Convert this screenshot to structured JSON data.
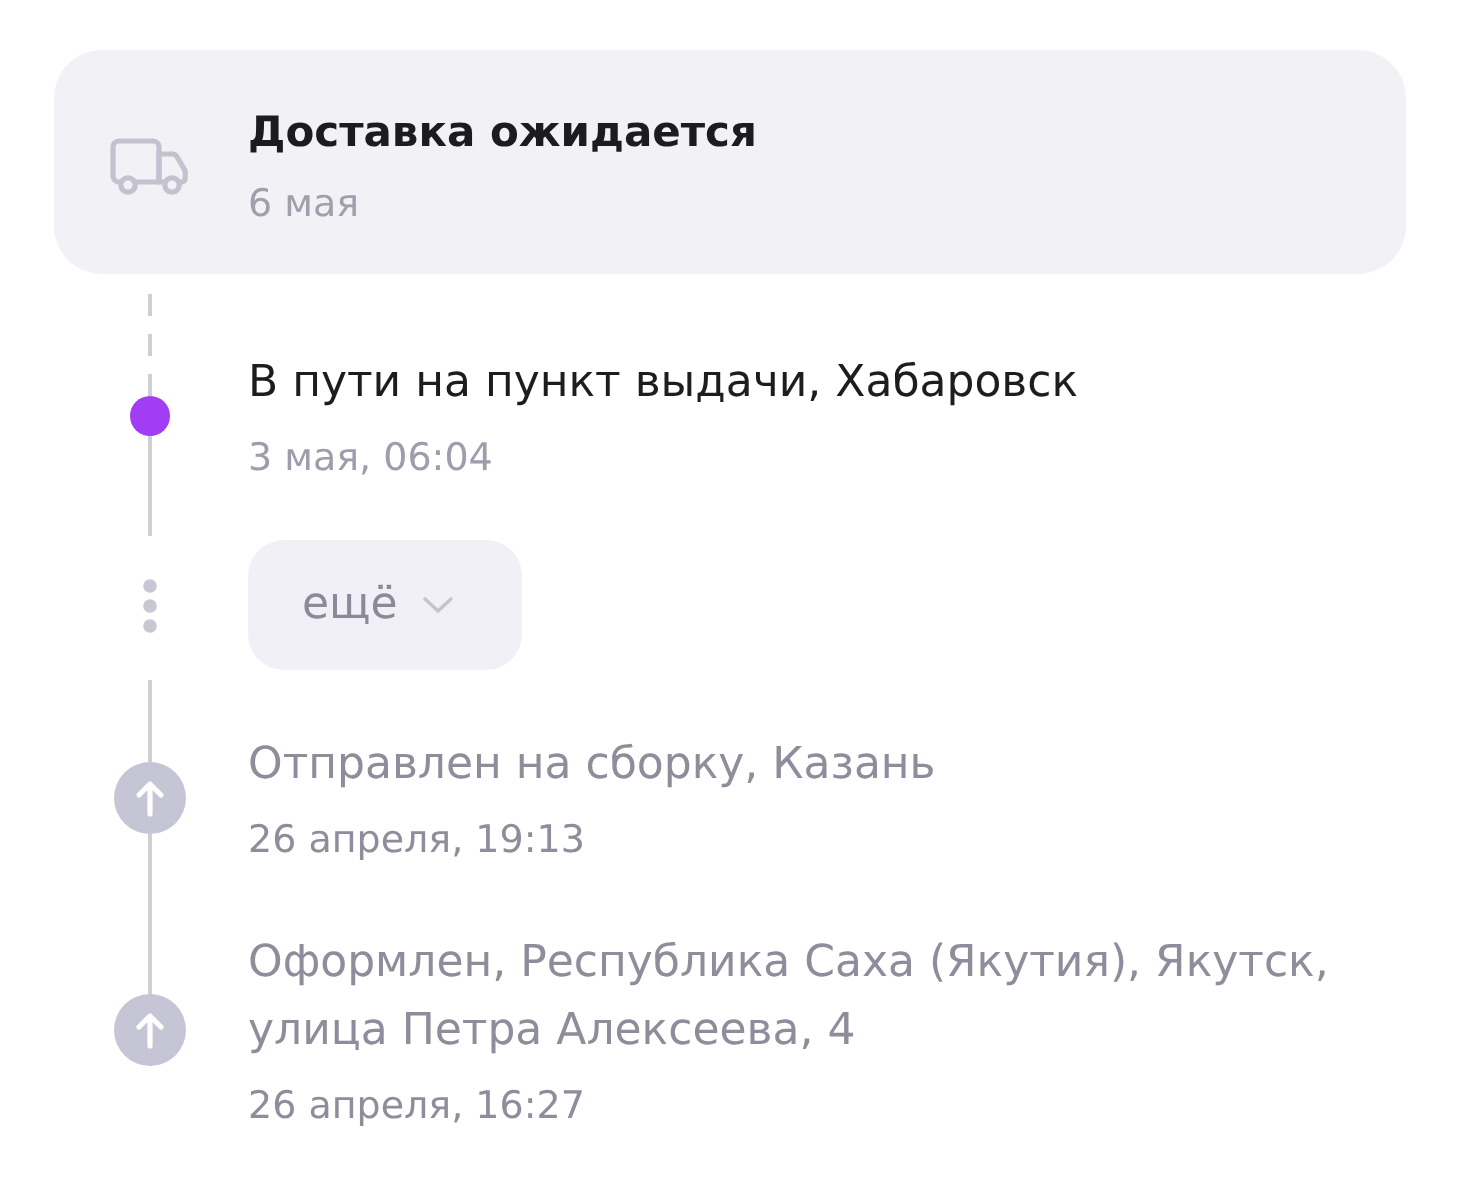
{
  "expected_delivery": {
    "title": "Доставка ожидается",
    "date": "6 мая"
  },
  "timeline": [
    {
      "kind": "current",
      "title": "В пути на пункт выдачи, Хабаровск",
      "date": "3 мая, 06:04"
    },
    {
      "kind": "more",
      "label": "ещё",
      "expanded": false
    },
    {
      "kind": "done",
      "title": "Отправлен на сборку, Казань",
      "date": "26 апреля, 19:13"
    },
    {
      "kind": "done",
      "title": "Оформлен, Республика Саха (Якутия), Якутск, улица Петра Алексеева, 4",
      "date": "26 апреля, 16:27"
    }
  ]
}
